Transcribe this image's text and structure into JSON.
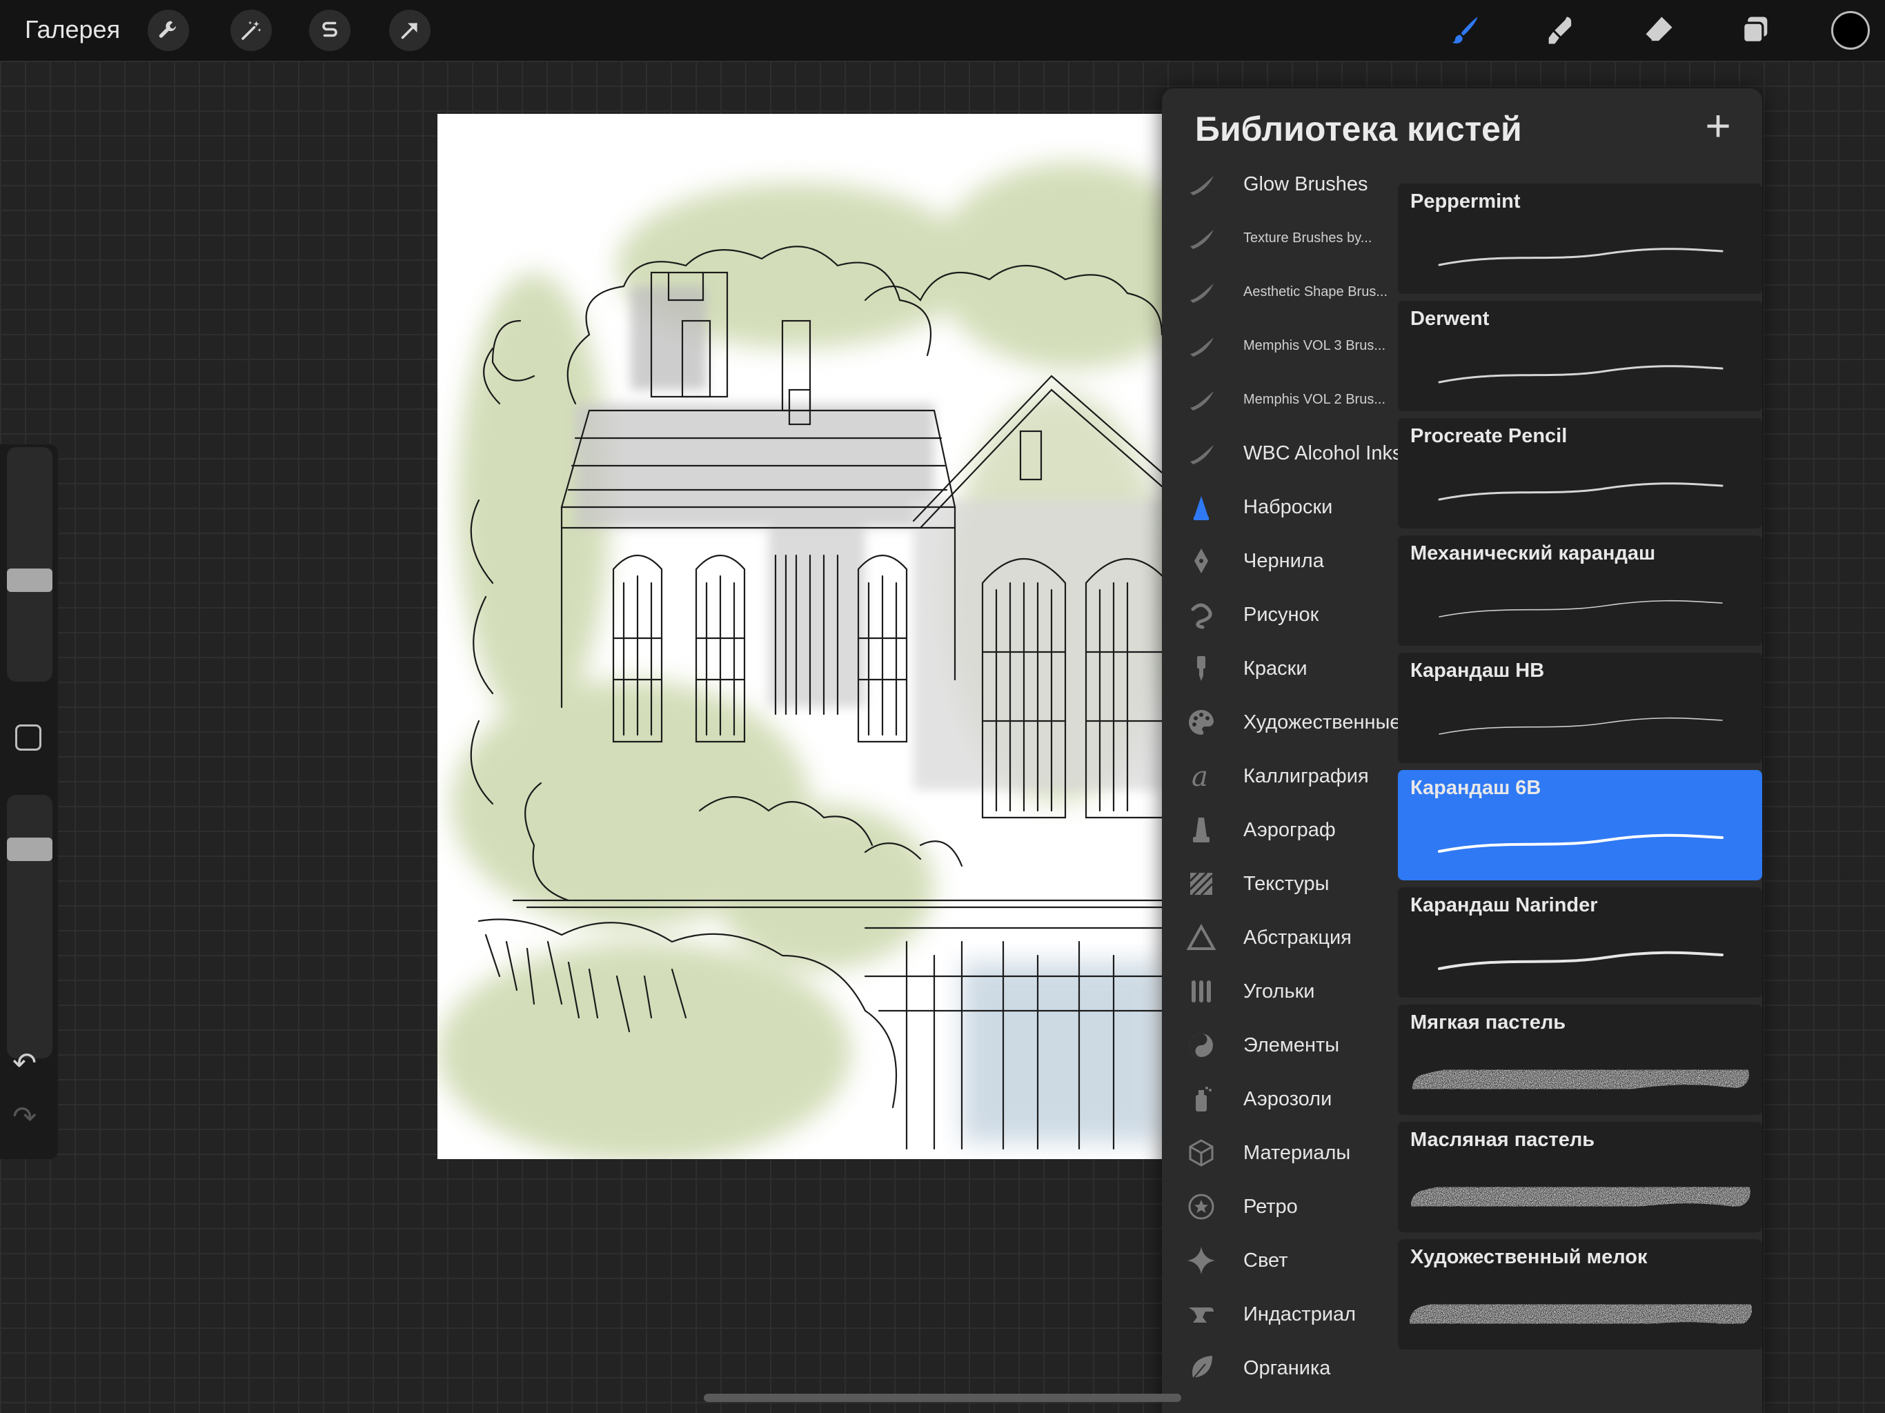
{
  "topbar": {
    "gallery_label": "Галерея"
  },
  "panel": {
    "title": "Библиотека кистей",
    "categories": [
      {
        "label": "Glow Brushes",
        "icon": "brush-stroke-icon",
        "small": false
      },
      {
        "label": "Texture Brushes by...",
        "icon": "brush-stroke-icon",
        "small": true
      },
      {
        "label": "Aesthetic Shape Brus...",
        "icon": "brush-stroke-icon",
        "small": true
      },
      {
        "label": "Memphis VOL 3 Brus...",
        "icon": "brush-stroke-icon",
        "small": true
      },
      {
        "label": "Memphis VOL 2 Brus...",
        "icon": "brush-stroke-icon",
        "small": true
      },
      {
        "label": "WBC Alcohol Inks",
        "icon": "brush-stroke-icon",
        "small": false
      },
      {
        "label": "Наброски",
        "icon": "pencil-tip-icon",
        "small": false
      },
      {
        "label": "Чернила",
        "icon": "ink-nib-icon",
        "small": false
      },
      {
        "label": "Рисунок",
        "icon": "swirl-icon",
        "small": false
      },
      {
        "label": "Краски",
        "icon": "paint-brush-icon",
        "small": false
      },
      {
        "label": "Художественные",
        "icon": "palette-icon",
        "small": false
      },
      {
        "label": "Каллиграфия",
        "icon": "calligraphy-icon",
        "small": false
      },
      {
        "label": "Аэрограф",
        "icon": "airbrush-icon",
        "small": false
      },
      {
        "label": "Текстуры",
        "icon": "texture-icon",
        "small": false
      },
      {
        "label": "Абстракция",
        "icon": "triangle-icon",
        "small": false
      },
      {
        "label": "Угольки",
        "icon": "charcoal-icon",
        "small": false
      },
      {
        "label": "Элементы",
        "icon": "yin-yang-icon",
        "small": false
      },
      {
        "label": "Аэрозоли",
        "icon": "spray-can-icon",
        "small": false
      },
      {
        "label": "Материалы",
        "icon": "cube-icon",
        "small": false
      },
      {
        "label": "Ретро",
        "icon": "star-circle-icon",
        "small": false
      },
      {
        "label": "Свет",
        "icon": "sparkle-icon",
        "small": false
      },
      {
        "label": "Индастриал",
        "icon": "anvil-icon",
        "small": false
      },
      {
        "label": "Органика",
        "icon": "leaf-icon",
        "small": false
      }
    ],
    "brushes": [
      {
        "name": "Peppermint",
        "stroke": "thin",
        "selected": false
      },
      {
        "name": "Derwent",
        "stroke": "thin",
        "selected": false
      },
      {
        "name": "Procreate Pencil",
        "stroke": "thin",
        "selected": false
      },
      {
        "name": "Механический карандаш",
        "stroke": "hair",
        "selected": false
      },
      {
        "name": "Карандаш HB",
        "stroke": "hair",
        "selected": false
      },
      {
        "name": "Карандаш 6B",
        "stroke": "medium",
        "selected": true
      },
      {
        "name": "Карандаш Narinder",
        "stroke": "medium",
        "selected": false
      },
      {
        "name": "Мягкая пастель",
        "stroke": "pastel",
        "selected": false
      },
      {
        "name": "Масляная пастель",
        "stroke": "oil",
        "selected": false
      },
      {
        "name": "Художественный мелок",
        "stroke": "crayon",
        "selected": false
      }
    ]
  },
  "colors": {
    "accent": "#2f79f4",
    "current_color": "#000000"
  }
}
